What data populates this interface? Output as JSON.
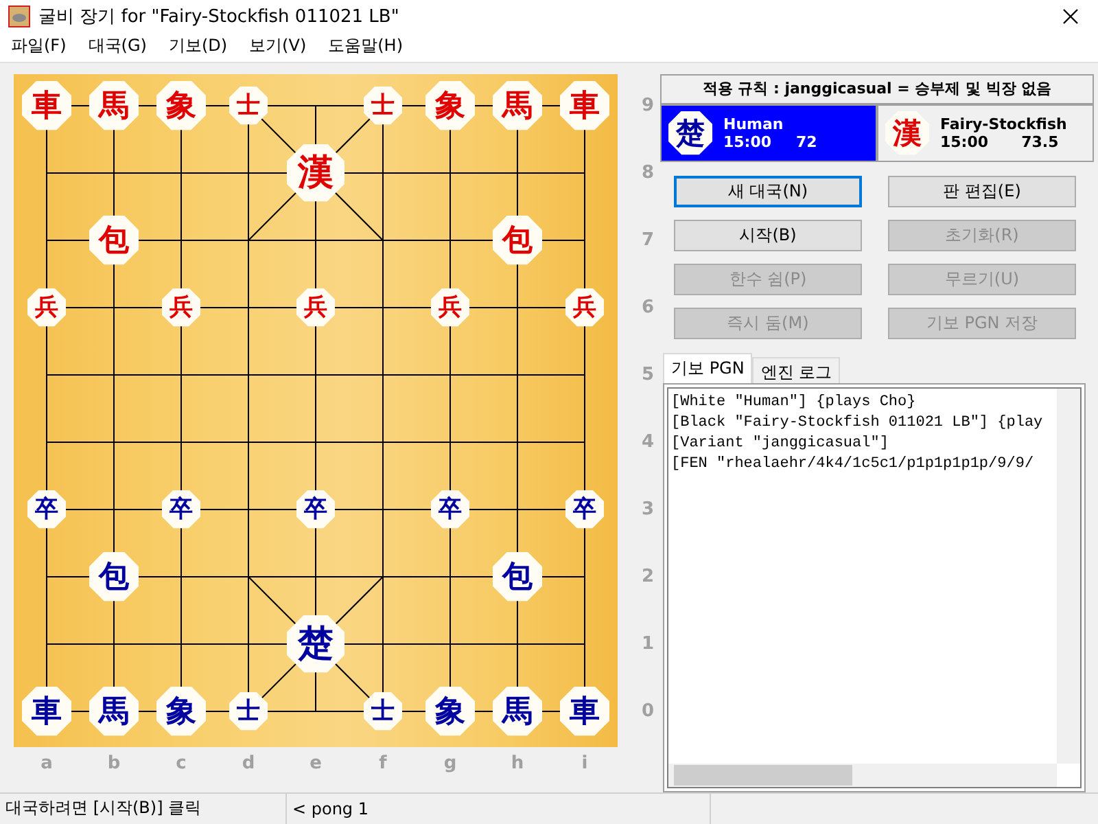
{
  "window": {
    "title": "굴비 장기 for \"Fairy-Stockfish 011021 LB\""
  },
  "menu": [
    "파일(F)",
    "대국(G)",
    "기보(D)",
    "보기(V)",
    "도움말(H)"
  ],
  "board": {
    "files": [
      "a",
      "b",
      "c",
      "d",
      "e",
      "f",
      "g",
      "h",
      "i"
    ],
    "ranks": [
      "9",
      "8",
      "7",
      "6",
      "5",
      "4",
      "3",
      "2",
      "1",
      "0"
    ],
    "rows": [
      [
        {
          "char": "車",
          "color": "#e00000",
          "kind": "major"
        },
        {
          "char": "馬",
          "color": "#e00000",
          "kind": "major"
        },
        {
          "char": "象",
          "color": "#e00000",
          "kind": "major"
        },
        {
          "char": "士",
          "color": "#e00000",
          "kind": "minor"
        },
        null,
        {
          "char": "士",
          "color": "#e00000",
          "kind": "minor"
        },
        {
          "char": "象",
          "color": "#e00000",
          "kind": "major"
        },
        {
          "char": "馬",
          "color": "#e00000",
          "kind": "major"
        },
        {
          "char": "車",
          "color": "#e00000",
          "kind": "major"
        }
      ],
      [
        null,
        null,
        null,
        null,
        {
          "char": "漢",
          "color": "#e00000",
          "kind": "general"
        },
        null,
        null,
        null,
        null
      ],
      [
        null,
        {
          "char": "包",
          "color": "#e00000",
          "kind": "major"
        },
        null,
        null,
        null,
        null,
        null,
        {
          "char": "包",
          "color": "#e00000",
          "kind": "major"
        },
        null
      ],
      [
        {
          "char": "兵",
          "color": "#e00000",
          "kind": "minor"
        },
        null,
        {
          "char": "兵",
          "color": "#e00000",
          "kind": "minor"
        },
        null,
        {
          "char": "兵",
          "color": "#e00000",
          "kind": "minor"
        },
        null,
        {
          "char": "兵",
          "color": "#e00000",
          "kind": "minor"
        },
        null,
        {
          "char": "兵",
          "color": "#e00000",
          "kind": "minor"
        }
      ],
      [
        null,
        null,
        null,
        null,
        null,
        null,
        null,
        null,
        null
      ],
      [
        null,
        null,
        null,
        null,
        null,
        null,
        null,
        null,
        null
      ],
      [
        {
          "char": "卒",
          "color": "#0000a0",
          "kind": "minor"
        },
        null,
        {
          "char": "卒",
          "color": "#0000a0",
          "kind": "minor"
        },
        null,
        {
          "char": "卒",
          "color": "#0000a0",
          "kind": "minor"
        },
        null,
        {
          "char": "卒",
          "color": "#0000a0",
          "kind": "minor"
        },
        null,
        {
          "char": "卒",
          "color": "#0000a0",
          "kind": "minor"
        }
      ],
      [
        null,
        {
          "char": "包",
          "color": "#0000a0",
          "kind": "major"
        },
        null,
        null,
        null,
        null,
        null,
        {
          "char": "包",
          "color": "#0000a0",
          "kind": "major"
        },
        null
      ],
      [
        null,
        null,
        null,
        null,
        {
          "char": "楚",
          "color": "#0000a0",
          "kind": "general"
        },
        null,
        null,
        null,
        null
      ],
      [
        {
          "char": "車",
          "color": "#0000a0",
          "kind": "major"
        },
        {
          "char": "馬",
          "color": "#0000a0",
          "kind": "major"
        },
        {
          "char": "象",
          "color": "#0000a0",
          "kind": "major"
        },
        {
          "char": "士",
          "color": "#0000a0",
          "kind": "minor"
        },
        null,
        {
          "char": "士",
          "color": "#0000a0",
          "kind": "minor"
        },
        {
          "char": "象",
          "color": "#0000a0",
          "kind": "major"
        },
        {
          "char": "馬",
          "color": "#0000a0",
          "kind": "major"
        },
        {
          "char": "車",
          "color": "#0000a0",
          "kind": "major"
        }
      ]
    ]
  },
  "rule": "적용 규칙 : janggicasual = 승부제 및 빅장 없음",
  "players": [
    {
      "emblem": "楚",
      "color": "#0000a0",
      "name": "Human",
      "time": "15:00",
      "score": "72",
      "selected": true
    },
    {
      "emblem": "漢",
      "color": "#e00000",
      "name": "Fairy-Stockfish",
      "time": "15:00",
      "score": "73.5",
      "selected": false
    }
  ],
  "buttons": [
    {
      "label": "새 대국(N)",
      "disabled": false,
      "focused": true
    },
    {
      "label": "판 편집(E)",
      "disabled": false,
      "focused": false
    },
    {
      "label": "시작(B)",
      "disabled": false,
      "focused": false
    },
    {
      "label": "초기화(R)",
      "disabled": true,
      "focused": false
    },
    {
      "label": "한수 쉼(P)",
      "disabled": true,
      "focused": false
    },
    {
      "label": "무르기(U)",
      "disabled": true,
      "focused": false
    },
    {
      "label": "즉시 둠(M)",
      "disabled": true,
      "focused": false
    },
    {
      "label": "기보 PGN 저장",
      "disabled": true,
      "focused": false
    }
  ],
  "tabs": [
    {
      "label": "기보 PGN",
      "selected": true
    },
    {
      "label": "엔진 로그",
      "selected": false
    }
  ],
  "pgn_lines": [
    "[White \"Human\"] {plays Cho}",
    "[Black \"Fairy-Stockfish 011021 LB\"] {play",
    "[Variant \"janggicasual\"]",
    "[FEN \"rhealaehr/4k4/1c5c1/p1p1p1p1p/9/9/"
  ],
  "status_bar": [
    "대국하려면 [시작(B)] 클릭",
    "< pong 1"
  ]
}
